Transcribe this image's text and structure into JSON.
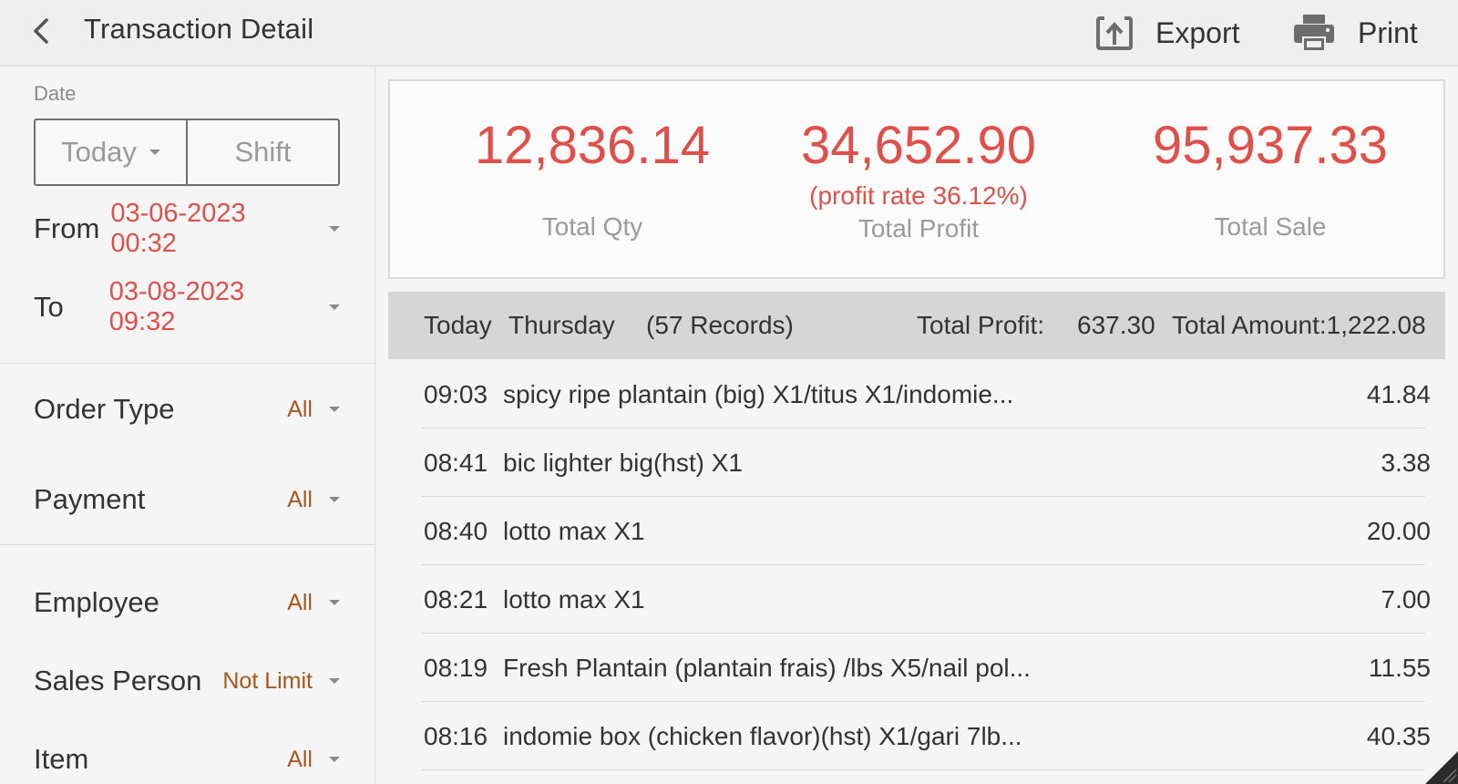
{
  "header": {
    "title": "Transaction Detail",
    "export_label": "Export",
    "print_label": "Print"
  },
  "filters": {
    "date_label": "Date",
    "period_options": [
      "Today",
      "Shift"
    ],
    "selected_period": "Today",
    "from_label": "From",
    "from_value": "03-06-2023 00:32",
    "to_label": "To",
    "to_value": "03-08-2023 09:32",
    "order_type_label": "Order Type",
    "order_type_value": "All",
    "payment_label": "Payment",
    "payment_value": "All",
    "employee_label": "Employee",
    "employee_value": "All",
    "sales_person_label": "Sales Person",
    "sales_person_value": "Not Limit",
    "item_label": "Item",
    "item_value": "All"
  },
  "summary": {
    "total_qty": "12,836.14",
    "total_qty_label": "Total Qty",
    "total_profit": "34,652.90",
    "profit_rate": "(profit rate 36.12%)",
    "total_profit_label": "Total Profit",
    "total_sale": "95,937.33",
    "total_sale_label": "Total Sale"
  },
  "group": {
    "day": "Today",
    "weekday": "Thursday",
    "records": "(57 Records)",
    "total_profit_label": "Total Profit:",
    "total_profit_value": "637.30",
    "total_amount": "Total Amount:1,222.08"
  },
  "transactions": [
    {
      "time": "09:03",
      "description": "spicy ripe plantain (big) X1/titus X1/indomie...",
      "amount": "41.84"
    },
    {
      "time": "08:41",
      "description": "bic lighter big(hst) X1",
      "amount": "3.38"
    },
    {
      "time": "08:40",
      "description": "lotto max X1",
      "amount": "20.00"
    },
    {
      "time": "08:21",
      "description": "lotto max X1",
      "amount": "7.00"
    },
    {
      "time": "08:19",
      "description": "Fresh Plantain (plantain frais) /lbs X5/nail pol...",
      "amount": "11.55"
    },
    {
      "time": "08:16",
      "description": "indomie box (chicken flavor)(hst) X1/gari 7lb...",
      "amount": "40.35"
    }
  ],
  "colors": {
    "accent_red": "#e0504a",
    "filter_value_brown": "#a8561b",
    "header_bg": "#efefef",
    "group_bar_bg": "#d6d6d6"
  },
  "icons": {
    "back": "chevron-left-icon",
    "export": "export-icon",
    "print": "printer-icon",
    "dropdown": "caret-down-icon"
  }
}
